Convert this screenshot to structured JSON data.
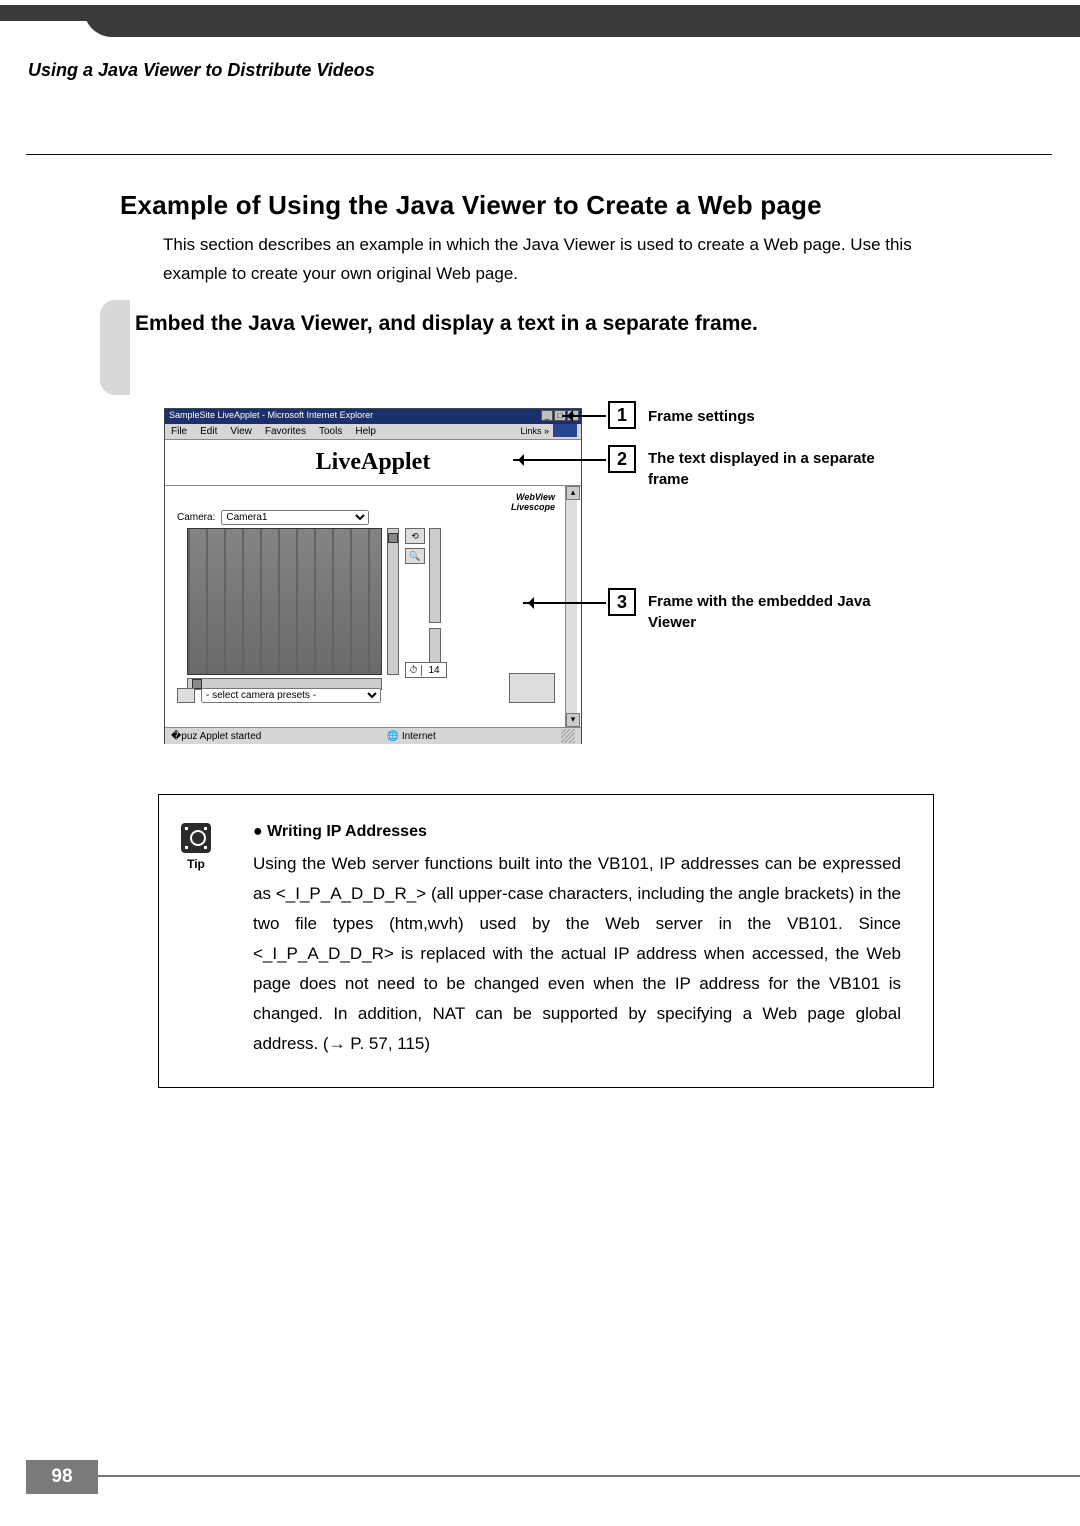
{
  "header": "Using a Java Viewer to Distribute Videos",
  "h1": "Example of Using the Java Viewer to Create a Web page",
  "intro": "This section describes an example in which the Java Viewer is used to create a Web page. Use this example to create your own original Web page.",
  "h2": "Embed the Java Viewer, and display a text in a separate frame.",
  "browser": {
    "title": "SampleSite LiveApplet - Microsoft Internet Explorer",
    "menus": [
      "File",
      "Edit",
      "View",
      "Favorites",
      "Tools",
      "Help"
    ],
    "links_label": "Links »",
    "frame_title": "LiveApplet",
    "wv_logo_line1": "WebView",
    "wv_logo_line2": "Livescope",
    "camera_label": "Camera:",
    "camera_value": "Camera1",
    "preset_value": "- select camera presets -",
    "counter": "14",
    "status_left": "Applet started",
    "status_right": "Internet"
  },
  "callouts": [
    {
      "n": "1",
      "label": "Frame settings"
    },
    {
      "n": "2",
      "label": "The text displayed in a separate frame"
    },
    {
      "n": "3",
      "label": "Frame with the embedded Java Viewer"
    }
  ],
  "tip": {
    "icon_label": "Tip",
    "heading": "Writing IP Addresses",
    "body": "Using the Web server functions built into the VB101, IP addresses can be expressed as <_I_P_A_D_D_R_> (all upper-case characters, including the angle brackets) in the two file types (htm,wvh) used by the Web server in the VB101. Since <_I_P_A_D_D_R> is replaced with the actual IP address when accessed, the Web page does not need to be changed even when the IP address for the VB101 is changed. In addition, NAT can be supported by specifying a Web page global address. (→ P. 57, 115)"
  },
  "page_number": "98"
}
